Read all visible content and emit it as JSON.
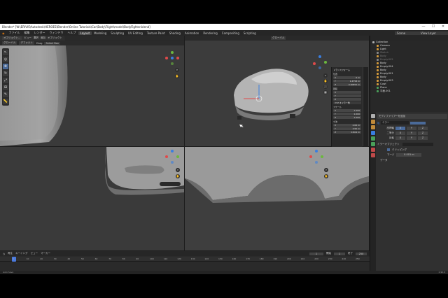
{
  "window": {
    "title": "Blender* [W:\\ERIVIS\\Autodesk\\HEROES\\Blender\\Online Tutorials\\Car\\Body\\Flight\\model\\BodyFighter.blend]",
    "controls": [
      "—",
      "☐",
      "✕"
    ]
  },
  "menu": {
    "items": [
      "ファイル",
      "編集",
      "レンダー",
      "ウィンドウ",
      "ヘルプ"
    ],
    "workspaces": [
      "Layout",
      "Modeling",
      "Sculpting",
      "UV Editing",
      "Texture Paint",
      "Shading",
      "Animation",
      "Rendering",
      "Compositing",
      "Scripting"
    ],
    "active_workspace": "Layout",
    "scene": "Scene",
    "view_layer": "View Layer"
  },
  "viewport_header": {
    "mode": "オブジェクト...",
    "items": [
      "ビュー",
      "選択",
      "追加",
      "オブジェクト"
    ],
    "transform": "グローバル"
  },
  "viewport_header2": {
    "mode": "グローバル",
    "items": [
      "デフォルト",
      "Drag",
      "Select Box"
    ]
  },
  "npanel": {
    "title": "トランスフォーム",
    "location_label": "位置",
    "location": [
      "0 m",
      "1.4758 m",
      "0.90855 m"
    ],
    "rotation_label": "回転",
    "rotation_mode": "XYZ オイラー角",
    "scale_label": "スケール",
    "scale": [
      "1.000",
      "1.000",
      "1.000"
    ],
    "dimensions_label": "寸法",
    "dimensions": [
      "2.06 m",
      "3.95 m",
      "0.804 m"
    ]
  },
  "outliner": {
    "rows": [
      {
        "label": "Collection",
        "color": "#b0b0b0",
        "dim": false
      },
      {
        "label": "Camera",
        "color": "#d49a3a",
        "dim": false
      },
      {
        "label": "Light",
        "color": "#d49a3a",
        "dim": false
      },
      {
        "label": "Sketch",
        "color": "#888888",
        "dim": true
      },
      {
        "label": "Body",
        "color": "#d49a3a",
        "dim": true
      },
      {
        "label": "Empty.002",
        "color": "#888888",
        "dim": true
      },
      {
        "label": "Body",
        "color": "#d49a3a",
        "dim": false
      },
      {
        "label": "Empty.004",
        "color": "#d49a3a",
        "dim": false
      },
      {
        "label": "Body",
        "color": "#d49a3a",
        "dim": false
      },
      {
        "label": "Empty.001",
        "color": "#d49a3a",
        "dim": false
      },
      {
        "label": "Body",
        "color": "#d49a3a",
        "dim": false
      },
      {
        "label": "Empty.003",
        "color": "#d49a3a",
        "dim": false
      },
      {
        "label": "Cowl",
        "color": "#d49a3a",
        "dim": false
      },
      {
        "label": "Plane",
        "color": "#4aa05a",
        "dim": false
      },
      {
        "label": "平面.001",
        "color": "#4aa05a",
        "dim": false
      }
    ]
  },
  "properties": {
    "title": "モディファイアーを追加",
    "modifier_name": "ミラー",
    "axis_label": "座標軸",
    "bisect_label": "二等分",
    "flip_label": "反転",
    "axes": [
      "X",
      "Y",
      "Z"
    ],
    "mirror_object_label": "ミラーオブジェクト",
    "clipping_label": "クリッピング",
    "merge_label": "マージ",
    "merge_value": "0.001 m",
    "data_label": "データ"
  },
  "timeline": {
    "menu": [
      "再生",
      "キーイング",
      "ビュー",
      "マーカー"
    ],
    "current_frame": "1",
    "start": "1",
    "end": "250",
    "start_label": "開始",
    "end_label": "終了",
    "ticks": [
      "0",
      "10",
      "20",
      "30",
      "40",
      "50",
      "60",
      "70",
      "80",
      "90",
      "100",
      "110",
      "120",
      "130",
      "140",
      "150",
      "160",
      "170",
      "180",
      "190",
      "200",
      "210",
      "220",
      "230",
      "240",
      "250"
    ]
  },
  "status": {
    "left": "Auto Save",
    "version": "2.90.0"
  }
}
